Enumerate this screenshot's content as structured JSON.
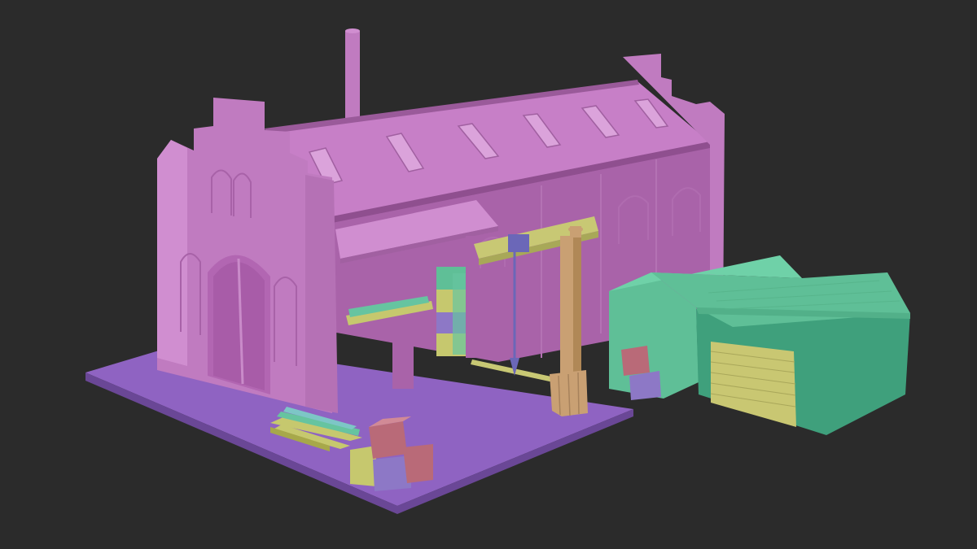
{
  "viewport": {
    "background": "#2b2b2b"
  },
  "scene": {
    "objects": [
      "factory-hall",
      "chimney",
      "roof-skylights",
      "side-canopy",
      "jib-crane",
      "crane-hook",
      "ground-platform",
      "stacked-crates",
      "lumber-pile",
      "small-warehouse",
      "warehouse-garage-door"
    ]
  },
  "palette": {
    "hall": "#c07bc0",
    "hall_shadow": "#a963a9",
    "hall_light": "#d08ed0",
    "roof": "#c77fc7",
    "platform": "#8f63c2",
    "platform_side": "#6a4796",
    "crane": "#c9a073",
    "crane_arm": "#c8c874",
    "hook": "#6b67b8",
    "warehouse": "#5fbf97",
    "warehouse_dark": "#3fa07c",
    "garage_door": "#c9c772",
    "crate_red": "#b96a78",
    "crate_blue": "#8d78c6",
    "crate_yellow": "#c6c86e",
    "lumber_green": "#66c4a0",
    "lumber_teal": "#7dc6c6"
  }
}
